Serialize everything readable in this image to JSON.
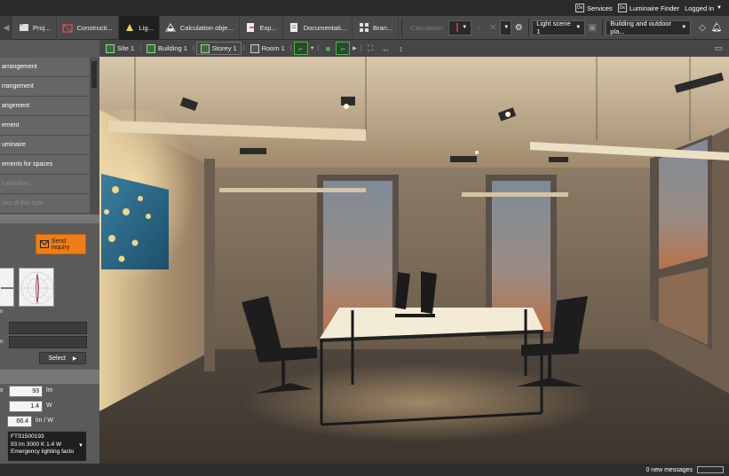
{
  "service_bar": {
    "services": "Services",
    "finder": "Luminaire Finder",
    "login": "Logged in",
    "dx_icon": "Dx"
  },
  "toolbar": {
    "items": [
      {
        "label": "Proj...",
        "icon": "project-icon"
      },
      {
        "label": "Constructi...",
        "icon": "construction-icon"
      },
      {
        "label": "Lig...",
        "icon": "light-icon"
      },
      {
        "label": "Calculation obje...",
        "icon": "calculation-object-icon"
      },
      {
        "label": "Exp...",
        "icon": "export-icon"
      },
      {
        "label": "Documentati...",
        "icon": "documentation-icon"
      },
      {
        "label": "Bran...",
        "icon": "brand-icon"
      }
    ],
    "calculation": "Calculation",
    "light_scene": "Light scene 1",
    "building_view": "Building and outdoor pla..."
  },
  "left_panel": {
    "menu": [
      {
        "label": "arrangement",
        "dim": false
      },
      {
        "label": "rrangement",
        "dim": false
      },
      {
        "label": "angement",
        "dim": false
      },
      {
        "label": "ement",
        "dim": false
      },
      {
        "label": "uminaire",
        "dim": false
      },
      {
        "label": "ements for spaces",
        "dim": false
      },
      {
        "label": "luminaires",
        "dim": true
      },
      {
        "label": "ires of this type",
        "dim": true
      }
    ],
    "send_inquiry": "Send inquiry",
    "small_label": "n",
    "field_label_2": "n",
    "select": "Select",
    "values": [
      {
        "label": "x",
        "value": "93",
        "unit": "lm"
      },
      {
        "label": "",
        "value": "1.4",
        "unit": "W"
      },
      {
        "label": "",
        "value": "66.4",
        "unit": "lm / W"
      }
    ],
    "luminaire": {
      "code": "FTS1500193",
      "specs": "93 lm   3000 K   1.4 W",
      "name": "Emergency lighting facto"
    }
  },
  "view_bar": {
    "breadcrumb": [
      "Site 1",
      "Building 1",
      "Storey 1",
      "Room 1"
    ]
  },
  "status": {
    "messages": "0 new messages"
  },
  "colors": {
    "accent_orange": "#f07e16",
    "active_green": "#4fb04f",
    "bar_dark": "#2b2b2b"
  }
}
